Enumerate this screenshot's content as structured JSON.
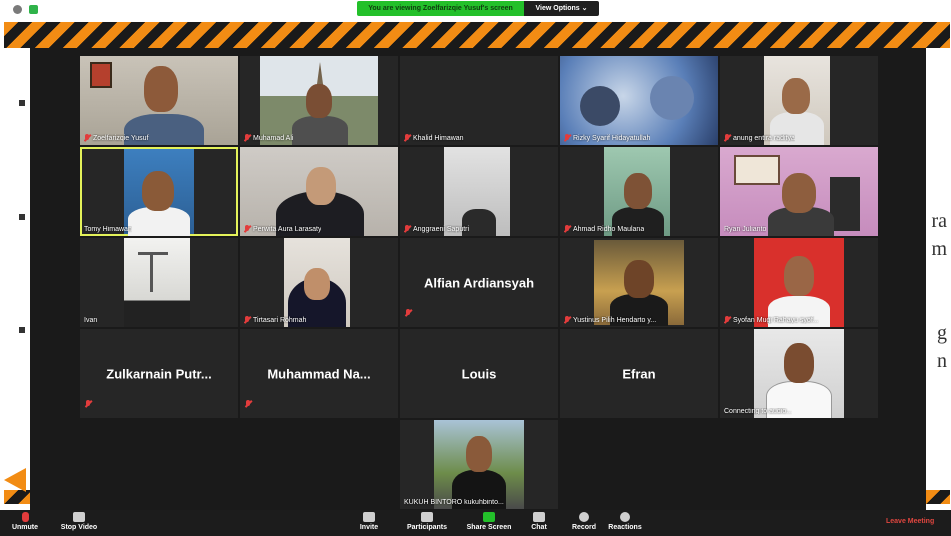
{
  "banner": {
    "viewing_text": "You are viewing Zoelfarizqie Yusuf's screen",
    "view_options_label": "View Options ⌄"
  },
  "slide": {
    "fragments": [
      "ra",
      "m",
      "g",
      "n"
    ]
  },
  "participants": [
    {
      "name": "Zoelfarizqie Yusuf",
      "muted": true
    },
    {
      "name": "Muhamad Ali",
      "muted": true
    },
    {
      "name": "Khalid Himawan",
      "muted": true
    },
    {
      "name": "Rizky Syarif Hidayatullah",
      "muted": true
    },
    {
      "name": "anung entira raditya",
      "muted": true
    },
    {
      "name": "Tomy Himawan",
      "muted": false,
      "active": true
    },
    {
      "name": "Perwita Aura Larasaty",
      "muted": true
    },
    {
      "name": "Anggraeni Saputri",
      "muted": true
    },
    {
      "name": "Ahmad Ridho Maulana",
      "muted": true
    },
    {
      "name": "Ryan Julianto",
      "muted": false
    },
    {
      "name": "Ivan",
      "muted": false
    },
    {
      "name": "Tirtasari Rohmah",
      "muted": true
    },
    {
      "name": "Alfian Ardiansyah",
      "muted": true
    },
    {
      "name": "Yustinus Pilih Hendarto y...",
      "muted": true
    },
    {
      "name": "Syofan Mugi Rahayu syof...",
      "muted": true
    },
    {
      "name": "Zulkarnain  Putr...",
      "muted": true
    },
    {
      "name": "Muhammad  Na...",
      "muted": true
    },
    {
      "name": "Louis",
      "muted": false
    },
    {
      "name": "Efran",
      "muted": false
    },
    {
      "name": "Connecting to audio...",
      "muted": false
    },
    {
      "name": "KUKUH BINTORO kukuhbinto...",
      "muted": false
    }
  ],
  "toolbar": {
    "unmute": "Unmute",
    "stop_video": "Stop Video",
    "invite": "Invite",
    "participants": "Participants",
    "share_screen": "Share Screen",
    "chat": "Chat",
    "record": "Record",
    "reactions": "Reactions",
    "leave": "Leave Meeting"
  },
  "colors": {
    "gallery_bg": "#1a1a1a",
    "tile_bg": "#262626",
    "active_speaker": "#e4f25a",
    "hazard_orange": "#f28c14",
    "share_green": "#23c02a",
    "leave_red": "#e0463f"
  }
}
